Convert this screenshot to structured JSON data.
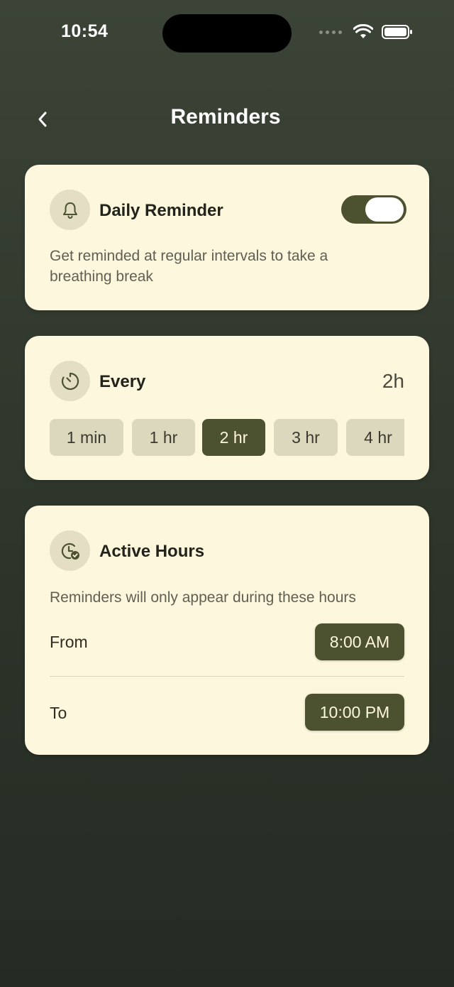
{
  "status": {
    "time": "10:54"
  },
  "header": {
    "title": "Reminders",
    "back_icon": "chevron-left-icon"
  },
  "daily_reminder": {
    "title": "Daily Reminder",
    "icon": "bell-icon",
    "enabled": true,
    "description_line1": "Get reminded at regular intervals to take a",
    "description_line2": "breathing break"
  },
  "every": {
    "title": "Every",
    "icon": "timer-icon",
    "value": "2h",
    "options": [
      {
        "label": "1 min",
        "selected": false
      },
      {
        "label": "1 hr",
        "selected": false
      },
      {
        "label": "2 hr",
        "selected": true
      },
      {
        "label": "3 hr",
        "selected": false
      },
      {
        "label": "4 hr",
        "selected": false
      }
    ]
  },
  "active_hours": {
    "title": "Active Hours",
    "icon": "clock-check-icon",
    "description": "Reminders will only appear during these hours",
    "from_label": "From",
    "from_value": "8:00 AM",
    "to_label": "To",
    "to_value": "10:00 PM"
  },
  "colors": {
    "card_bg": "#fdf7dd",
    "accent": "#4c5230",
    "chip_bg": "#dcd8bd"
  }
}
